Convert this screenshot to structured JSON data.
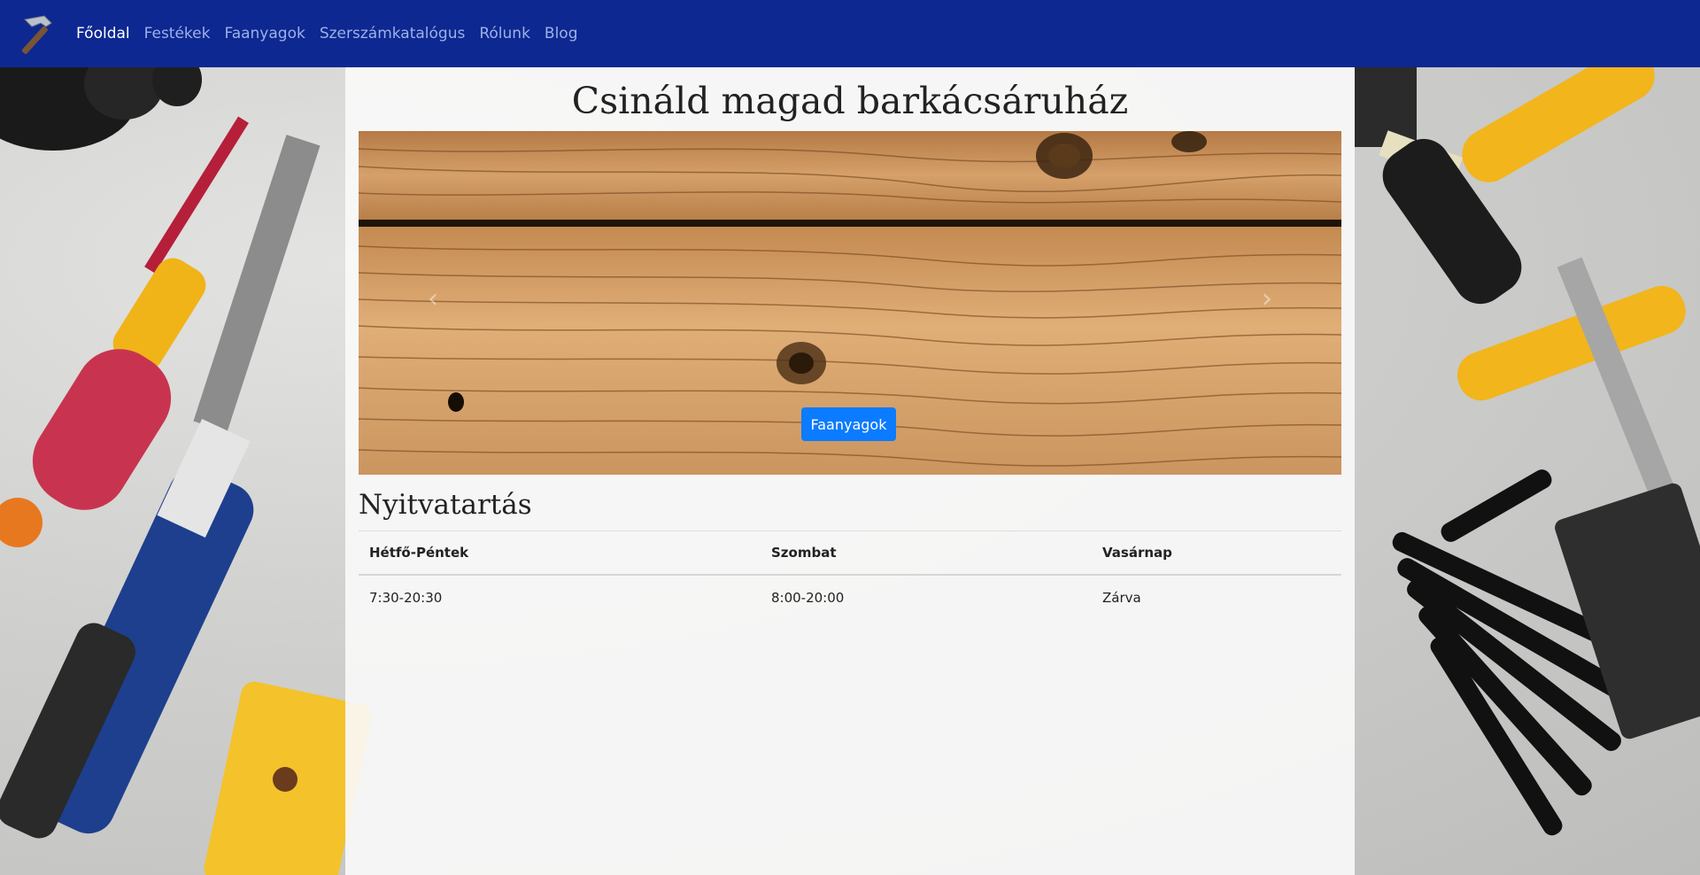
{
  "navbar": {
    "brand_icon": "hammer-icon",
    "items": [
      {
        "label": "Főoldal",
        "active": true
      },
      {
        "label": "Festékek",
        "active": false
      },
      {
        "label": "Faanyagok",
        "active": false
      },
      {
        "label": "Szerszámkatalógus",
        "active": false
      },
      {
        "label": "Rólunk",
        "active": false
      },
      {
        "label": "Blog",
        "active": false
      }
    ]
  },
  "main": {
    "title": "Csináld magad barkácsáruház",
    "carousel": {
      "button_label": "Faanyagok",
      "prev_icon": "chevron-left-icon",
      "next_icon": "chevron-right-icon"
    },
    "hours": {
      "heading": "Nyitvatartás",
      "columns": [
        "Hétfő-Péntek",
        "Szombat",
        "Vasárnap"
      ],
      "values": [
        "7:30-20:30",
        "8:00-20:00",
        "Zárva"
      ]
    }
  },
  "colors": {
    "navbar": "#0d2891",
    "nav_active": "#ffffff",
    "nav_inactive": "#9fb0e6",
    "button": "#0b7bff"
  }
}
